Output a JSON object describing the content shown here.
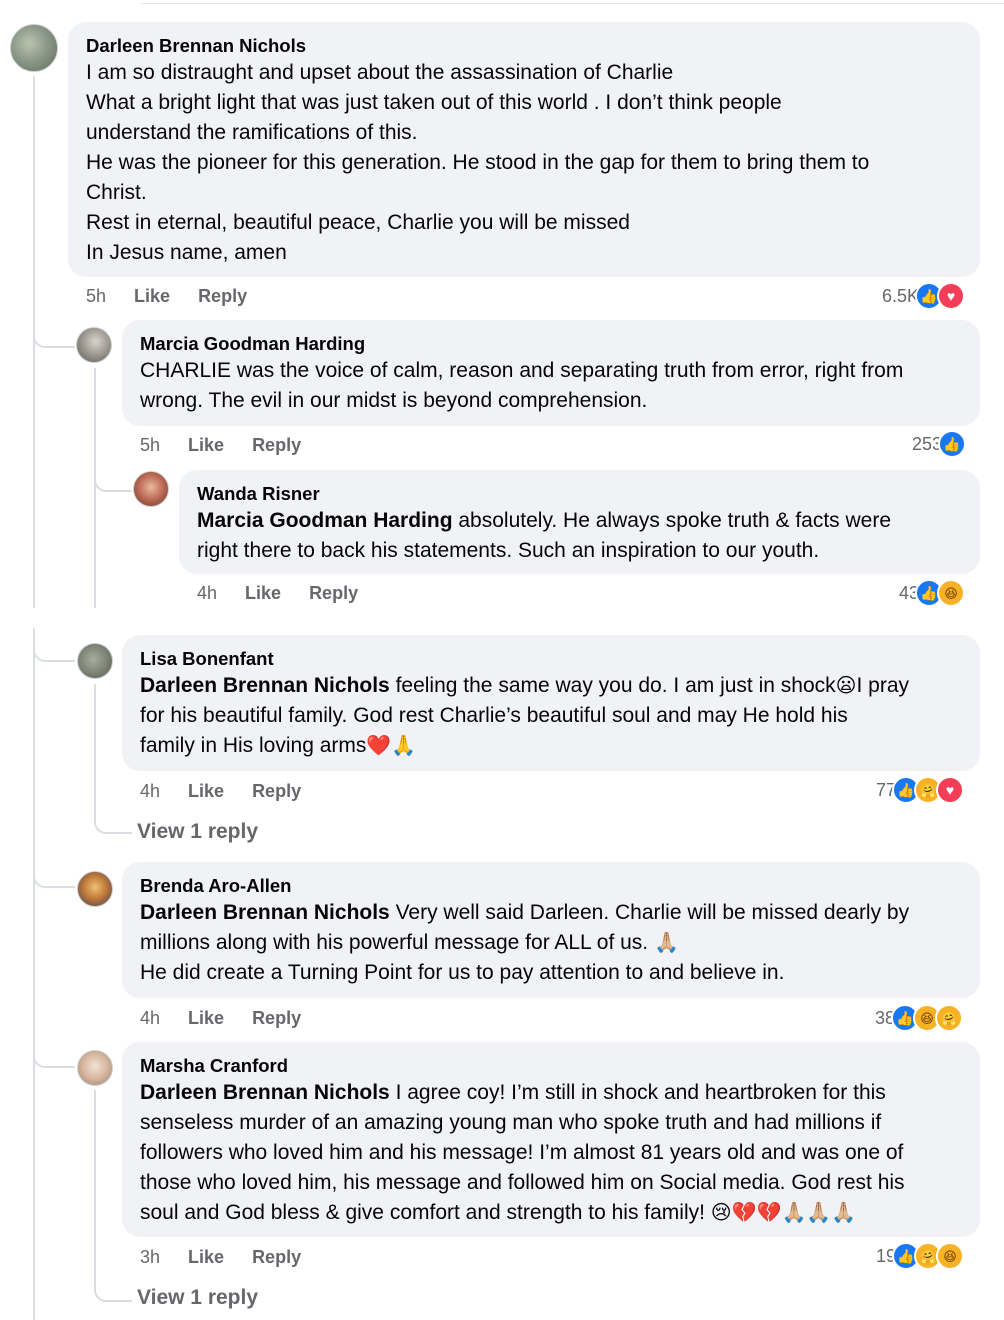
{
  "comments": [
    {
      "author": "Darleen Brennan Nichols",
      "lines": [
        "I am so distraught and upset about the assassination of Charlie",
        "What a bright light that was just taken out of this world . I don’t think people",
        "understand the ramifications of this.",
        "He was the pioneer for this generation. He stood in the gap for them to bring them to",
        "Christ.",
        "Rest in eternal, beautiful peace, Charlie you will be missed",
        "In Jesus name, amen"
      ],
      "time": "5h",
      "like": "Like",
      "reply": "Reply",
      "count": "6.5K",
      "reactions": [
        "like-icon",
        "love-icon"
      ]
    },
    {
      "author": "Marcia Goodman Harding",
      "lines": [
        "CHARLIE was the voice of calm, reason and separating truth from error, right from",
        "wrong. The evil in our midst is beyond comprehension."
      ],
      "time": "5h",
      "like": "Like",
      "reply": "Reply",
      "count": "253",
      "reactions": [
        "like-icon"
      ]
    },
    {
      "author": "Wanda Risner",
      "mention": "Marcia Goodman Harding",
      "line1_rest": " absolutely. He always spoke truth & facts were",
      "line2": "right there to back his statements. Such an inspiration to our youth.",
      "time": "4h",
      "like": "Like",
      "reply": "Reply",
      "count": "43",
      "reactions": [
        "like-icon",
        "haha-icon"
      ]
    },
    {
      "author": "Lisa Bonenfant",
      "mention": "Darleen Brennan Nichols",
      "line1_rest": " feeling the same way you do. I am just in shock",
      "line1_emoji": "😦",
      "line1_tail": "I pray",
      "line2": "for his beautiful family. God rest Charlie’s beautiful soul and may He hold his",
      "line3": "family in His loving arms",
      "line3_emoji": "❤️🙏",
      "time": "4h",
      "like": "Like",
      "reply": "Reply",
      "count": "77",
      "reactions": [
        "like-icon",
        "care-icon",
        "love-icon"
      ],
      "view_reply": "View 1 reply"
    },
    {
      "author": "Brenda Aro-Allen",
      "mention": "Darleen Brennan Nichols",
      "line1_rest": " Very well said Darleen. Charlie will be missed dearly by",
      "line2": "millions along with his powerful message for ALL of us. ",
      "line2_emoji": "🙏🏼",
      "line3": "He did create a Turning Point for us to pay attention to and believe in.",
      "time": "4h",
      "like": "Like",
      "reply": "Reply",
      "count": "38",
      "reactions": [
        "like-icon",
        "haha-icon",
        "care-icon"
      ]
    },
    {
      "author": "Marsha Cranford",
      "mention": "Darleen Brennan Nichols",
      "line1_rest": " I agree coy! I’m still in shock and heartbroken for this",
      "line2": "senseless murder of an amazing young man who spoke truth and had millions if",
      "line3": "followers who loved him and his message! I’m almost 81 years old and was one of",
      "line4": "those who loved him, his message and followed him on Social media. God rest his",
      "line5": "soul and God bless & give comfort and strength to his family! ",
      "line5_emoji": "😢💔💔🙏🏼🙏🏼🙏🏼",
      "time": "3h",
      "like": "Like",
      "reply": "Reply",
      "count": "19",
      "reactions": [
        "like-icon",
        "care-icon",
        "haha-icon"
      ],
      "view_reply": "View 1 reply"
    }
  ],
  "colors": {
    "bubble": "#f0f2f5",
    "meta_text": "#65676b",
    "like_blue": "#1877f2",
    "love_red": "#f33e58",
    "emoji_yellow": "#f7b125"
  }
}
